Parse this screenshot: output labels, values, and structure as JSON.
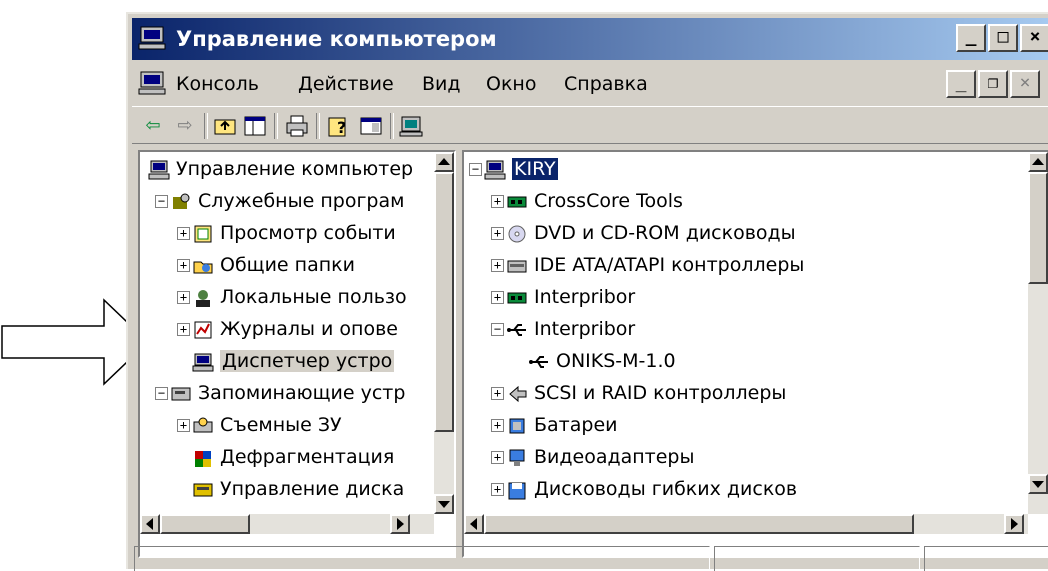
{
  "window": {
    "title": "Управление компьютером",
    "buttons": {
      "minimize": "_",
      "maximize": "□",
      "close": "×"
    }
  },
  "menubar": {
    "items": [
      "Консоль",
      "Действие",
      "Вид",
      "Окно",
      "Справка"
    ],
    "mdi_buttons": {
      "minimize": "_",
      "restore": "❐",
      "close": "×"
    }
  },
  "toolbar": {
    "icons": [
      "back-arrow-icon",
      "forward-arrow-icon",
      "up-folder-icon",
      "show-tree-icon",
      "print-icon",
      "help-icon",
      "properties-icon",
      "device-icon"
    ]
  },
  "left_tree": {
    "items": [
      {
        "label": "Управление компьютер",
        "icon": "computer-icon",
        "expander": "",
        "level": 0
      },
      {
        "label": "Служебные програм",
        "icon": "tools-icon",
        "expander": "−",
        "level": 1
      },
      {
        "label": "Просмотр событи",
        "icon": "event-viewer-icon",
        "expander": "+",
        "level": 2
      },
      {
        "label": "Общие папки",
        "icon": "shared-folder-icon",
        "expander": "+",
        "level": 2
      },
      {
        "label": "Локальные пользо",
        "icon": "users-icon",
        "expander": "+",
        "level": 2
      },
      {
        "label": "Журналы и опове",
        "icon": "logs-icon",
        "expander": "+",
        "level": 2
      },
      {
        "label": "Диспетчер устро",
        "icon": "device-manager-icon",
        "expander": "",
        "level": 2,
        "selected": true
      },
      {
        "label": "Запоминающие устр",
        "icon": "storage-icon",
        "expander": "−",
        "level": 1
      },
      {
        "label": "Съемные ЗУ",
        "icon": "removable-storage-icon",
        "expander": "+",
        "level": 2
      },
      {
        "label": "Дефрагментация",
        "icon": "defrag-icon",
        "expander": "",
        "level": 2
      },
      {
        "label": "Управление диска",
        "icon": "disk-management-icon",
        "expander": "",
        "level": 2
      }
    ]
  },
  "right_tree": {
    "items": [
      {
        "label": "KIRY",
        "icon": "computer-icon",
        "expander": "−",
        "level": 0,
        "selected": true
      },
      {
        "label": "CrossCore Tools",
        "icon": "board-icon",
        "expander": "+",
        "level": 1
      },
      {
        "label": "DVD и CD-ROM дисководы",
        "icon": "cdrom-icon",
        "expander": "+",
        "level": 1
      },
      {
        "label": "IDE ATA/ATAPI контроллеры",
        "icon": "ide-controller-icon",
        "expander": "+",
        "level": 1
      },
      {
        "label": "Interpribor",
        "icon": "board-icon",
        "expander": "+",
        "level": 1
      },
      {
        "label": "Interpribor",
        "icon": "usb-icon",
        "expander": "−",
        "level": 1
      },
      {
        "label": "ONIKS-M-1.0",
        "icon": "usb-icon",
        "expander": "",
        "level": 2
      },
      {
        "label": "SCSI и RAID контроллеры",
        "icon": "scsi-icon",
        "expander": "+",
        "level": 1
      },
      {
        "label": "Батареи",
        "icon": "battery-icon",
        "expander": "+",
        "level": 1
      },
      {
        "label": "Видеоадаптеры",
        "icon": "display-adapter-icon",
        "expander": "+",
        "level": 1
      },
      {
        "label": "Дисководы гибких дисков",
        "icon": "floppy-icon",
        "expander": "+",
        "level": 1
      }
    ]
  },
  "colors": {
    "title_gradient_start": "#0a246a",
    "title_gradient_end": "#a6caf0",
    "face": "#d4d0c8",
    "selection": "#0a246a"
  }
}
